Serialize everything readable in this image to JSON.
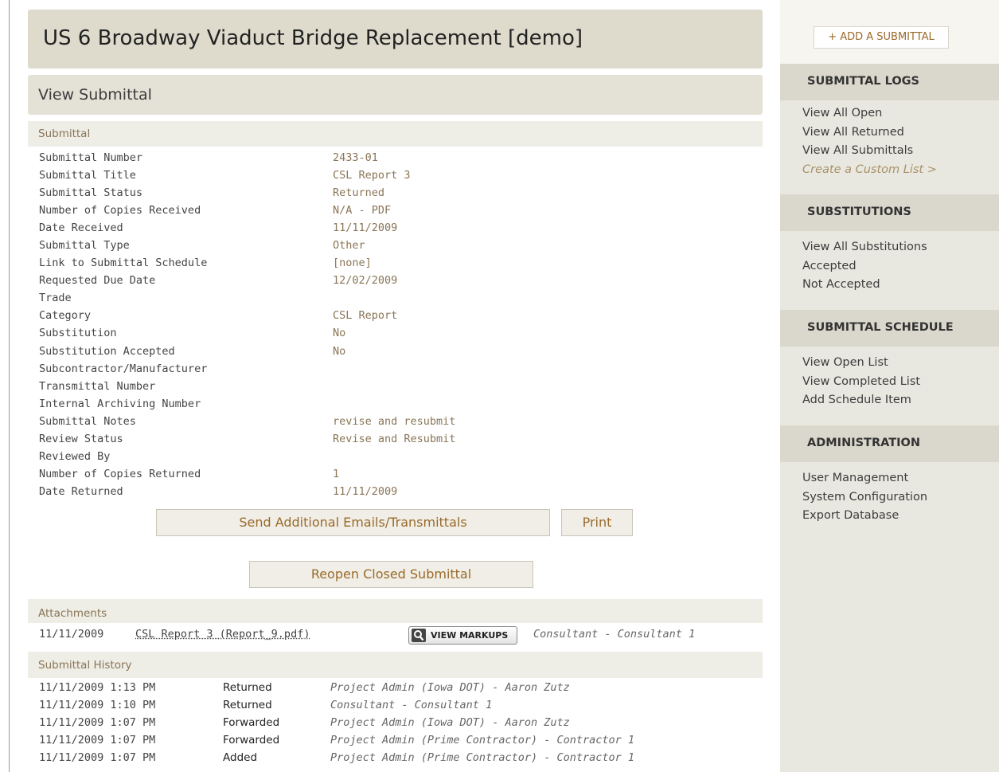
{
  "project": {
    "title": "US 6 Broadway Viaduct Bridge Replacement [demo]"
  },
  "page": {
    "title": "View Submittal"
  },
  "submittal": {
    "section_label": "Submittal",
    "fields": [
      {
        "label": "Submittal Number",
        "value": "2433-01"
      },
      {
        "label": "Submittal Title",
        "value": "CSL Report 3"
      },
      {
        "label": "Submittal Status",
        "value": "Returned"
      },
      {
        "label": "Number of Copies Received",
        "value": "N/A - PDF"
      },
      {
        "label": "Date Received",
        "value": "11/11/2009"
      },
      {
        "label": "Submittal Type",
        "value": "Other"
      },
      {
        "label": "Link to Submittal Schedule",
        "value": "[none]"
      },
      {
        "label": "Requested Due Date",
        "value": "12/02/2009"
      },
      {
        "label": "Trade",
        "value": ""
      },
      {
        "label": "Category",
        "value": "CSL Report"
      },
      {
        "label": "Substitution",
        "value": "No"
      },
      {
        "label": "Substitution Accepted",
        "value": "No"
      },
      {
        "label": "Subcontractor/Manufacturer",
        "value": ""
      },
      {
        "label": "Transmittal Number",
        "value": ""
      },
      {
        "label": "Internal Archiving Number",
        "value": ""
      },
      {
        "label": "Submittal Notes",
        "value": "revise and resubmit"
      },
      {
        "label": "Review Status",
        "value": "Revise and Resubmit"
      },
      {
        "label": "Reviewed By",
        "value": ""
      },
      {
        "label": "Number of Copies Returned",
        "value": "1"
      },
      {
        "label": "Date Returned",
        "value": "11/11/2009"
      }
    ]
  },
  "actions": {
    "send_emails": "Send Additional Emails/Transmittals",
    "print": "Print",
    "reopen": "Reopen Closed Submittal"
  },
  "attachments": {
    "section_label": "Attachments",
    "items": [
      {
        "date": "11/11/2009",
        "name": "CSL Report 3 (Report_9.pdf)",
        "markups_label": "VIEW MARKUPS",
        "by": "Consultant - Consultant 1"
      }
    ]
  },
  "history": {
    "section_label": "Submittal History",
    "rows": [
      {
        "time": "11/11/2009 1:13 PM",
        "action": "Returned",
        "by": "Project Admin (Iowa DOT) - Aaron Zutz"
      },
      {
        "time": "11/11/2009 1:10 PM",
        "action": "Returned",
        "by": "Consultant - Consultant 1"
      },
      {
        "time": "11/11/2009 1:07 PM",
        "action": "Forwarded",
        "by": "Project Admin (Iowa DOT) - Aaron Zutz"
      },
      {
        "time": "11/11/2009 1:07 PM",
        "action": "Forwarded",
        "by": "Project Admin (Prime Contractor) - Contractor 1"
      },
      {
        "time": "11/11/2009 1:07 PM",
        "action": "Added",
        "by": "Project Admin (Prime Contractor) - Contractor 1"
      }
    ]
  },
  "sidebar": {
    "add_button": "+ ADD A SUBMITTAL",
    "sections": [
      {
        "title": "SUBMITTAL LOGS",
        "links": [
          "View All Open",
          "View All Returned",
          "View All Submittals",
          "Create a Custom List >"
        ]
      },
      {
        "title": "SUBSTITUTIONS",
        "links": [
          "View All Substitutions",
          "Accepted",
          "Not Accepted"
        ]
      },
      {
        "title": "SUBMITTAL SCHEDULE",
        "links": [
          "View Open List",
          "View Completed List",
          "Add Schedule Item"
        ]
      },
      {
        "title": "ADMINISTRATION",
        "links": [
          "User Management",
          "System Configuration",
          "Export Database"
        ]
      }
    ]
  },
  "colors": {
    "accent": "#9a6a2a",
    "value_text": "#8a7556",
    "header_bg": "#dedbcd",
    "sidebar_bg": "#e9e8e0"
  },
  "icons": {
    "markups": "magnifier-icon"
  }
}
